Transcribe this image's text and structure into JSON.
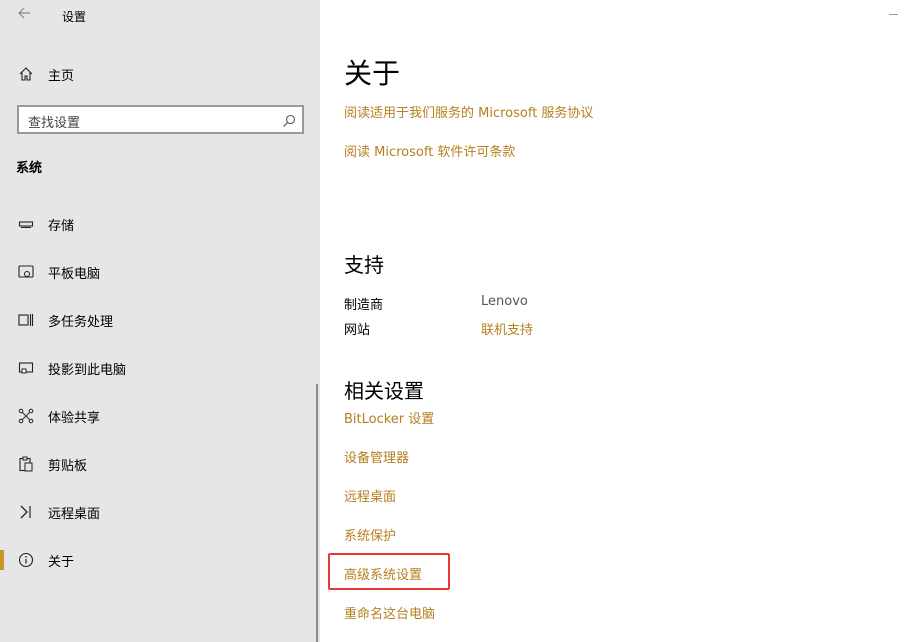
{
  "window": {
    "title": "设置",
    "back_icon": "back-arrow-icon"
  },
  "sidebar": {
    "home_label": "主页",
    "search": {
      "placeholder": "查找设置"
    },
    "section_title": "系统",
    "items": [
      {
        "label": "存储",
        "icon": "storage-icon"
      },
      {
        "label": "平板电脑",
        "icon": "tablet-icon"
      },
      {
        "label": "多任务处理",
        "icon": "multitasking-icon"
      },
      {
        "label": "投影到此电脑",
        "icon": "project-icon"
      },
      {
        "label": "体验共享",
        "icon": "share-icon"
      },
      {
        "label": "剪贴板",
        "icon": "clipboard-icon"
      },
      {
        "label": "远程桌面",
        "icon": "remote-desktop-icon"
      },
      {
        "label": "关于",
        "icon": "info-icon",
        "selected": true
      }
    ]
  },
  "main": {
    "title": "关于",
    "links_top": [
      "阅读适用于我们服务的 Microsoft 服务协议",
      "阅读 Microsoft 软件许可条款"
    ],
    "support": {
      "heading": "支持",
      "manufacturer_label": "制造商",
      "manufacturer_value": "Lenovo",
      "website_label": "网站",
      "website_value": "联机支持"
    },
    "related": {
      "heading": "相关设置",
      "links": [
        "BitLocker 设置",
        "设备管理器",
        "远程桌面",
        "系统保护",
        "高级系统设置",
        "重命名这台电脑"
      ]
    }
  },
  "colors": {
    "accent": "#b57f1e",
    "highlight": "#e53935",
    "sidebar_bg": "#e6e6e6"
  }
}
